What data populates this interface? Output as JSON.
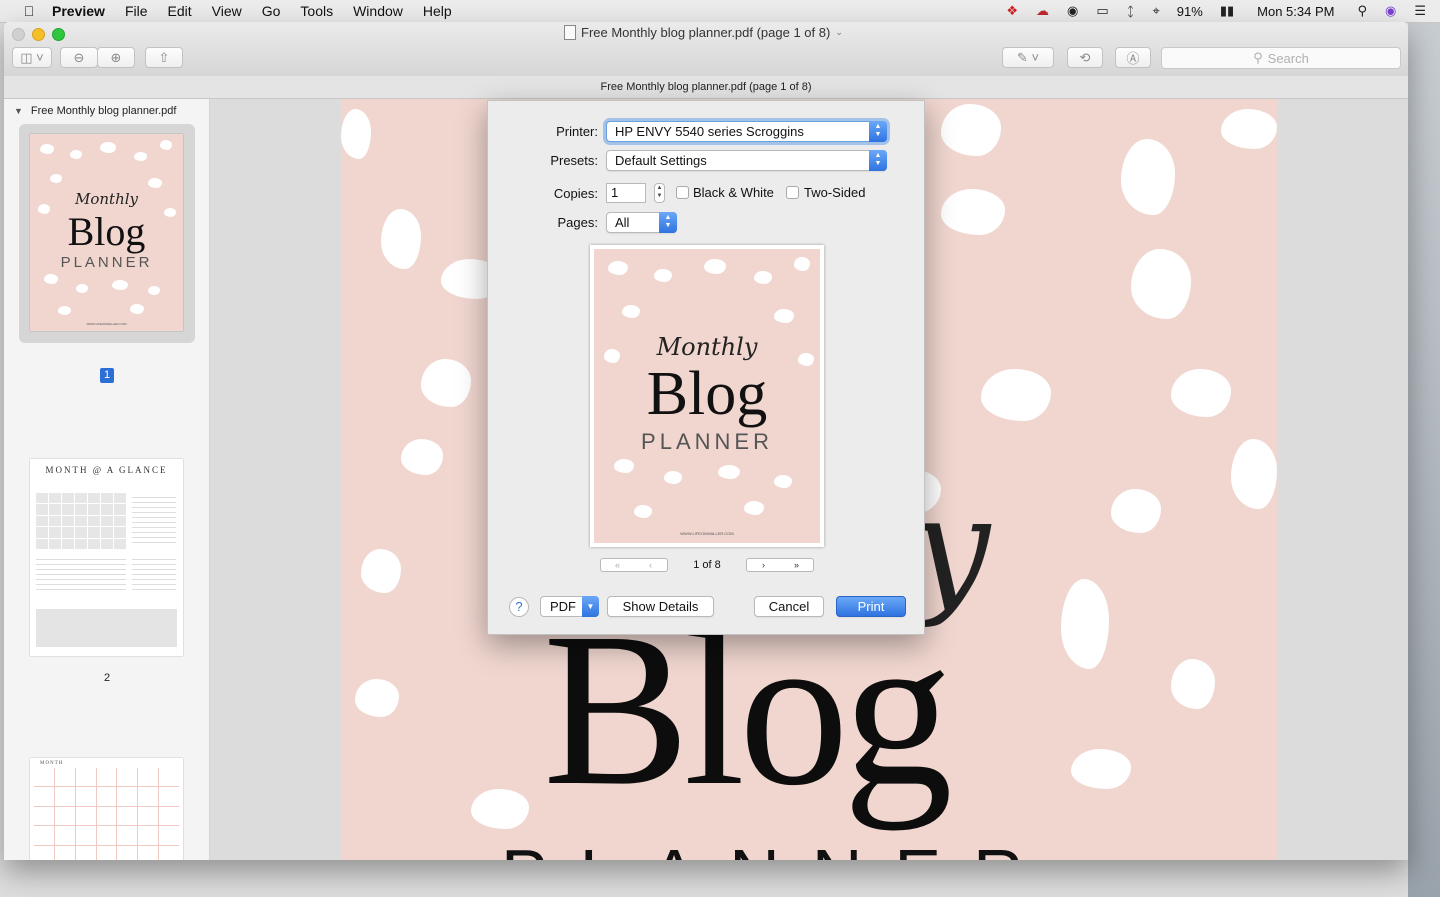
{
  "menubar": {
    "app": "Preview",
    "items": [
      "File",
      "Edit",
      "View",
      "Go",
      "Tools",
      "Window",
      "Help"
    ],
    "battery": "91%",
    "clock": "Mon 5:34 PM"
  },
  "window": {
    "title": "Free Monthly blog planner.pdf (page 1 of 8)",
    "subtitle": "Free Monthly blog planner.pdf (page 1 of 8)",
    "search_placeholder": "Search"
  },
  "sidebar": {
    "document": "Free Monthly blog planner.pdf",
    "pages": [
      {
        "number": "1",
        "selected": true
      },
      {
        "number": "2",
        "selected": false
      }
    ],
    "page2_heading": "MONTH @ A GLANCE",
    "page3_heading": "MONTH"
  },
  "cover": {
    "script": "Monthly",
    "title": "Blog",
    "subtitle": "PLANNER",
    "url": "WWW.LIFEONWALLER.COM"
  },
  "print_dialog": {
    "printer_label": "Printer:",
    "printer_value": "HP ENVY 5540 series Scroggins",
    "presets_label": "Presets:",
    "presets_value": "Default Settings",
    "copies_label": "Copies:",
    "copies_value": "1",
    "bw_label": "Black & White",
    "two_sided_label": "Two-Sided",
    "pages_label": "Pages:",
    "pages_value": "All",
    "page_indicator": "1 of 8",
    "help_label": "?",
    "pdf_label": "PDF",
    "show_details_label": "Show Details",
    "cancel_label": "Cancel",
    "print_label": "Print"
  },
  "colors": {
    "accent": "#2f73e0",
    "cover_pink": "#f0d6cf"
  }
}
